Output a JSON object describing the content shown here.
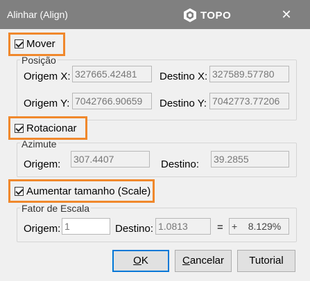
{
  "window": {
    "title": "Alinhar  (Align)",
    "logo_text": "TOPO"
  },
  "mover": {
    "checkbox_label": "Mover",
    "group_title": "Posição",
    "origem_x_label": "Origem X:",
    "origem_x_value": "327665.42481",
    "destino_x_label": "Destino X:",
    "destino_x_value": "327589.57780",
    "origem_y_label": "Origem Y:",
    "origem_y_value": "7042766.90659",
    "destino_y_label": "Destino Y:",
    "destino_y_value": "7042773.77206"
  },
  "rotacionar": {
    "checkbox_label": "Rotacionar",
    "group_title": "Azimute",
    "origem_label": "Origem:",
    "origem_value": "307.4407",
    "destino_label": "Destino:",
    "destino_value": "39.2855"
  },
  "scale": {
    "checkbox_label": "Aumentar tamanho (Scale)",
    "group_title": "Fator de Escala",
    "origem_label": "Origem:",
    "origem_value": "1",
    "destino_label": "Destino:",
    "destino_value": "1.0813",
    "equals": "=",
    "percent_value": "+    8.129%"
  },
  "buttons": {
    "ok_first": "O",
    "ok_rest": "K",
    "cancel_first": "C",
    "cancel_rest": "ancelar",
    "tutorial": "Tutorial"
  },
  "colors": {
    "titlebar": "#808080",
    "highlight": "#f0882c",
    "window_bg": "#f0f0f0"
  }
}
